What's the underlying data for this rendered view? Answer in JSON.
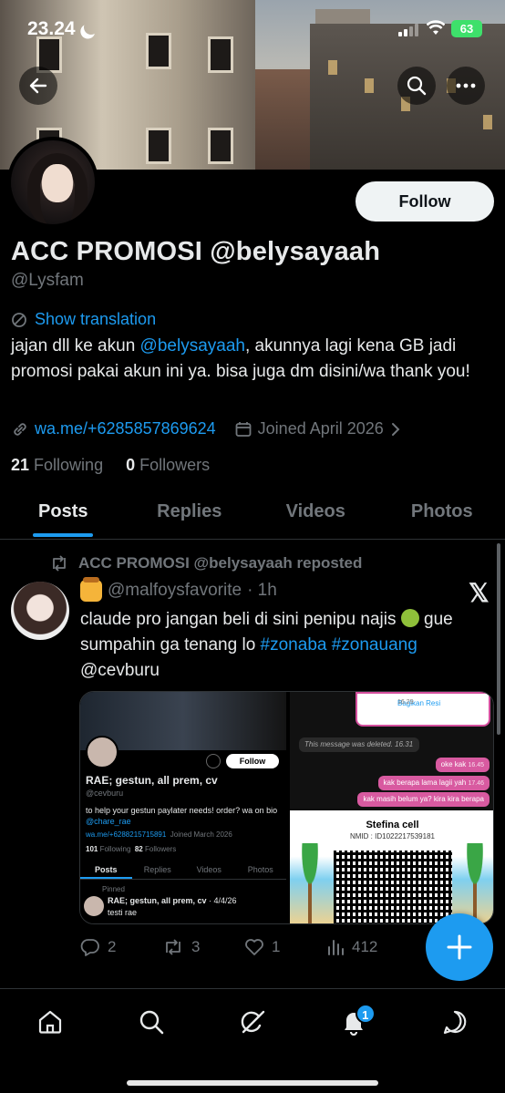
{
  "status_bar": {
    "time": "23.24",
    "battery": "63"
  },
  "profile": {
    "display_name": "ACC PROMOSI @belysayaah",
    "handle": "@Lysfam",
    "follow_label": "Follow",
    "show_translation": "Show translation",
    "bio_part1": "jajan dll ke akun ",
    "bio_mention": "@belysayaah",
    "bio_part2": ", akunnya lagi kena GB jadi promosi pakai akun ini ya. bisa juga dm disini/wa thank you!",
    "link": "wa.me/+6285857869624",
    "joined": "Joined April 2026",
    "following_count": "21",
    "following_label": "Following",
    "followers_count": "0",
    "followers_label": "Followers"
  },
  "tabs": [
    "Posts",
    "Replies",
    "Videos",
    "Photos"
  ],
  "post": {
    "repost_label": "ACC PROMOSI @belysayaah reposted",
    "author_handle": "@malfoysfavorite",
    "time_ago": "· 1h",
    "text_part1": "claude pro jangan beli di sini penipu najis ",
    "text_part2": " gue sumpahin ga tenang lo ",
    "tag1": "#zonaba",
    "tag2": "#zonauang",
    "text_part3": " @cevburu",
    "actions": {
      "replies": "2",
      "reposts": "3",
      "likes": "1",
      "views": "412"
    },
    "media": {
      "left": {
        "follow": "Follow",
        "name": "RAE; gestun, all prem, cv",
        "handle": "@cevburu",
        "bio": "to help your gestun paylater needs! order? wa on bio",
        "bio_mention": "@chare_rae",
        "link": "wa.me/+6288215715891",
        "joined": "Joined March 2026",
        "following": "101",
        "following_label": "Following",
        "followers": "82",
        "followers_label": "Followers",
        "tabs": [
          "Posts",
          "Replies",
          "Videos",
          "Photos"
        ],
        "pinned": "Pinned",
        "pinned_title": "RAE; gestun, all prem, cv",
        "pinned_date": "· 4/4/26",
        "pinned_text": "testi rae"
      },
      "right": {
        "card_label": "Bagikan Resi",
        "card_time": "16.29",
        "deleted": "This message was deleted. 16.31",
        "bubble1": "oke kak",
        "bubble1_time": "16.45",
        "bubble2": "kak berapa lama lagii yah",
        "bubble2_time": "17.46",
        "bubble3": "kak masih belum ya? kira kira berapa",
        "qr_title": "Stefina cell",
        "qr_nmid": "NMID : ID1022217539181"
      }
    }
  },
  "notifications_badge": "1",
  "colors": {
    "accent": "#1d9bf0",
    "background": "#000000",
    "muted": "#71767b"
  }
}
